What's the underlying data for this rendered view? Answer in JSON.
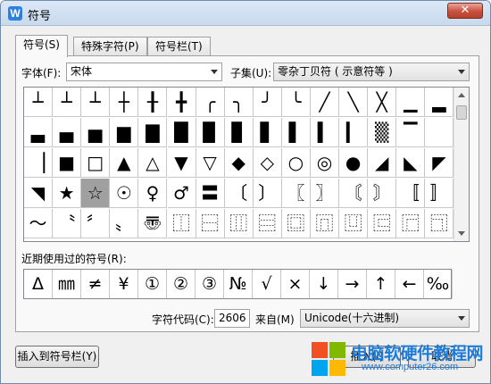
{
  "window": {
    "title": "符号",
    "app_icon": "W",
    "close": "✕"
  },
  "tabs": [
    {
      "label": "符号(S)",
      "active": true
    },
    {
      "label": "特殊字符(P)",
      "active": false
    },
    {
      "label": "符号栏(T)",
      "active": false
    }
  ],
  "font": {
    "label": "字体(F):",
    "value": "宋体"
  },
  "subset": {
    "label": "子集(U):",
    "value": "零杂丁贝符 ( 示意符等 )"
  },
  "symbols": [
    [
      "┴",
      "┴",
      "┴",
      "┼",
      "╂",
      "╋",
      "╭",
      "╮",
      "╯",
      "╰",
      "╱",
      "╲",
      "╳",
      "▁",
      "▂"
    ],
    [
      "▃",
      "▄",
      "▅",
      "▆",
      "▇",
      "█",
      "▉",
      "▊",
      "▋",
      "▌",
      "▍",
      "▎",
      "▒",
      "▔",
      ""
    ],
    [
      "▕",
      "■",
      "□",
      "▲",
      "△",
      "▼",
      "▽",
      "◆",
      "◇",
      "○",
      "◎",
      "●",
      "◢",
      "◣",
      "◤"
    ],
    [
      "◥",
      "★",
      "☆",
      "☉",
      "♀",
      "♂",
      "〓",
      "〔",
      "〕",
      "〖",
      "〗",
      "〘",
      "〙",
      "〚",
      "〛"
    ],
    [
      "〜",
      "〝",
      "〞",
      "〟",
      "〠",
      "⿰",
      "⿱",
      "⿲",
      "⿳",
      "⿴",
      "⿵",
      "⿶",
      "⿷",
      "⿸",
      "⿹"
    ]
  ],
  "selected_symbol": "☆",
  "recent": {
    "label": "近期使用过的符号(R):",
    "items": [
      "Δ",
      "㎜",
      "≠",
      "¥",
      "①",
      "②",
      "③",
      "№",
      "√",
      "×",
      "↓",
      "→",
      "↑",
      "←",
      "‰"
    ]
  },
  "char_code": {
    "label": "字符代码(C):",
    "value": "2606"
  },
  "source": {
    "label": "来自(M)",
    "value": "Unicode(十六进制)"
  },
  "buttons": {
    "insert_to_bar": "插入到符号栏(Y)",
    "insert": "插入(I)",
    "cancel": "取消"
  },
  "watermark": {
    "name": "电脑软硬件教程网",
    "url": "www.computer26.com"
  },
  "colors": {
    "accent": "#1e7bd8",
    "selected_cell": "#a0a0a0",
    "close_button": "#c8503e"
  }
}
